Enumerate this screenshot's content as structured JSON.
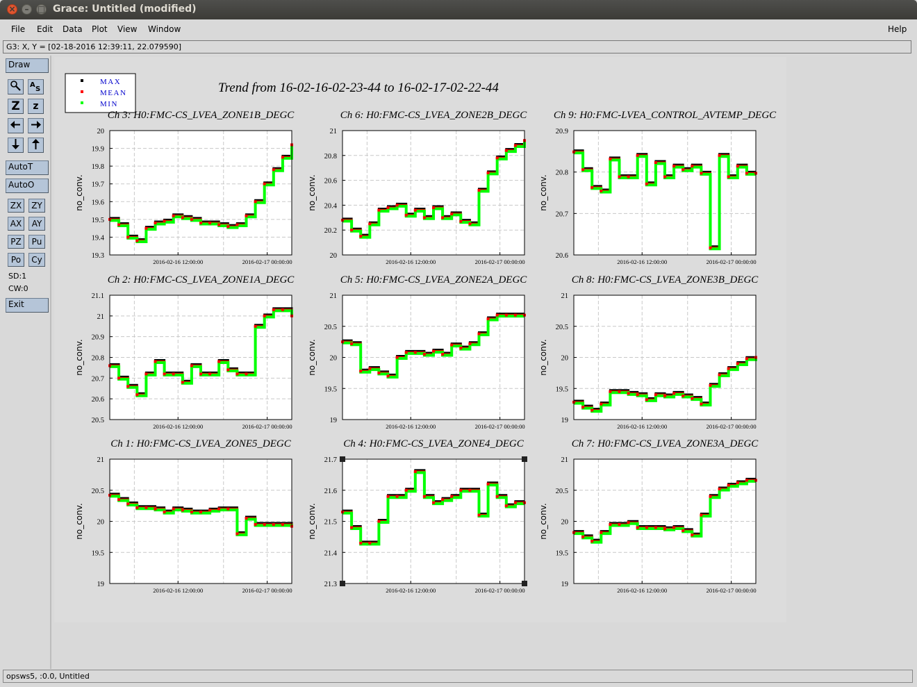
{
  "window": {
    "title": "Grace: Untitled (modified)"
  },
  "menu": {
    "file": "File",
    "edit": "Edit",
    "data": "Data",
    "plot": "Plot",
    "view": "View",
    "window": "Window",
    "help": "Help"
  },
  "locator": {
    "text": "G3: X, Y = [02-18-2016 12:39:11, 22.079590]"
  },
  "toolbar": {
    "draw": "Draw",
    "autot": "AutoT",
    "autoo": "AutoO",
    "zx": "ZX",
    "zy": "ZY",
    "ax": "AX",
    "ay": "AY",
    "pz": "PZ",
    "pu": "Pu",
    "po": "Po",
    "cy": "Cy",
    "sd": "SD:1",
    "cw": "CW:0",
    "exit": "Exit",
    "icons": [
      "magnifier-icon",
      "autoscale-text-icon",
      "zoom-in-icon",
      "zoom-out-icon",
      "arrow-left-icon",
      "arrow-right-icon",
      "arrow-down-icon",
      "arrow-up-icon"
    ],
    "zoom_in_glyph": "Z",
    "zoom_out_glyph": "z"
  },
  "status": {
    "text": "opsws5, :0.0, Untitled"
  },
  "colors": {
    "max": "#000000",
    "mean": "#ff0000",
    "min": "#00ff00",
    "legend_text": "#0000cc",
    "canvas": "#dcdcdc"
  },
  "page_title": "Trend from 16-02-16-02-23-44 to 16-02-17-02-22-44",
  "legend": [
    {
      "label": "MAX"
    },
    {
      "label": "MEAN"
    },
    {
      "label": "MIN"
    }
  ],
  "chart_data": [
    {
      "type": "scatter",
      "title": "Ch 3: H0:FMC-CS_LVEA_ZONE1B_DEGC",
      "ylabel": "no_conv.",
      "ylim": [
        19.3,
        20
      ],
      "yticks": [
        "20",
        "19.9",
        "19.8",
        "19.7",
        "19.6",
        "19.5",
        "19.4",
        "19.3"
      ],
      "xticks": [
        "2016-02-16 12:00:00",
        "2016-02-17 00:00:00"
      ],
      "x": [
        0,
        0.05,
        0.1,
        0.15,
        0.2,
        0.25,
        0.3,
        0.35,
        0.4,
        0.45,
        0.5,
        0.55,
        0.6,
        0.65,
        0.7,
        0.75,
        0.8,
        0.85,
        0.9,
        0.95,
        1
      ],
      "y": [
        19.5,
        19.47,
        19.4,
        19.38,
        19.45,
        19.48,
        19.49,
        19.52,
        19.51,
        19.5,
        19.48,
        19.48,
        19.47,
        19.46,
        19.47,
        19.52,
        19.6,
        19.7,
        19.78,
        19.85,
        19.92
      ]
    },
    {
      "type": "scatter",
      "title": "Ch 6: H0:FMC-CS_LVEA_ZONE2B_DEGC",
      "ylabel": "no_conv.",
      "ylim": [
        20,
        21
      ],
      "yticks": [
        "21",
        "20.8",
        "20.6",
        "20.4",
        "20.2",
        "20"
      ],
      "xticks": [
        "2016-02-16 12:00:00",
        "2016-02-17 00:00:00"
      ],
      "x": [
        0,
        0.05,
        0.1,
        0.15,
        0.2,
        0.25,
        0.3,
        0.35,
        0.4,
        0.45,
        0.5,
        0.55,
        0.6,
        0.65,
        0.7,
        0.75,
        0.8,
        0.85,
        0.9,
        0.95,
        1
      ],
      "y": [
        20.28,
        20.2,
        20.15,
        20.25,
        20.36,
        20.38,
        20.4,
        20.32,
        20.36,
        20.3,
        20.38,
        20.3,
        20.33,
        20.27,
        20.25,
        20.52,
        20.66,
        20.78,
        20.84,
        20.88,
        20.92
      ]
    },
    {
      "type": "scatter",
      "title": "Ch 9: H0:FMC-LVEA_CONTROL_AVTEMP_DEGC",
      "ylabel": "no_conv.",
      "ylim": [
        20.6,
        20.95
      ],
      "yticks": [
        "20.9",
        "20.8",
        "20.7",
        "20.6"
      ],
      "xticks": [
        "2016-02-16 12:00:00",
        "2016-02-17 00:00:00"
      ],
      "x": [
        0,
        0.05,
        0.1,
        0.15,
        0.2,
        0.25,
        0.3,
        0.35,
        0.4,
        0.45,
        0.5,
        0.55,
        0.6,
        0.65,
        0.7,
        0.75,
        0.8,
        0.85,
        0.9,
        0.95,
        1
      ],
      "y": [
        20.89,
        20.84,
        20.79,
        20.78,
        20.87,
        20.82,
        20.82,
        20.88,
        20.8,
        20.86,
        20.82,
        20.85,
        20.84,
        20.85,
        20.83,
        20.62,
        20.88,
        20.82,
        20.85,
        20.83,
        20.83
      ]
    },
    {
      "type": "scatter",
      "title": "Ch 2: H0:FMC-CS_LVEA_ZONE1A_DEGC",
      "ylabel": "no_conv.",
      "ylim": [
        20.5,
        21.1
      ],
      "yticks": [
        "21.1",
        "21",
        "20.9",
        "20.8",
        "20.7",
        "20.6",
        "20.5"
      ],
      "xticks": [
        "2016-02-16 12:00:00",
        "2016-02-17 00:00:00"
      ],
      "x": [
        0,
        0.05,
        0.1,
        0.15,
        0.2,
        0.25,
        0.3,
        0.35,
        0.4,
        0.45,
        0.5,
        0.55,
        0.6,
        0.65,
        0.7,
        0.75,
        0.8,
        0.85,
        0.9,
        0.95,
        1
      ],
      "y": [
        20.76,
        20.7,
        20.66,
        20.62,
        20.72,
        20.78,
        20.72,
        20.72,
        20.68,
        20.76,
        20.72,
        20.72,
        20.78,
        20.74,
        20.72,
        20.72,
        20.95,
        21.0,
        21.03,
        21.03,
        21.0
      ]
    },
    {
      "type": "scatter",
      "title": "Ch 5: H0:FMC-CS_LVEA_ZONE2A_DEGC",
      "ylabel": "no_conv.",
      "ylim": [
        19,
        21
      ],
      "yticks": [
        "21",
        "20.5",
        "20",
        "19.5",
        "19"
      ],
      "xticks": [
        "2016-02-16 12:00:00",
        "2016-02-17 00:00:00"
      ],
      "x": [
        0,
        0.05,
        0.1,
        0.15,
        0.2,
        0.25,
        0.3,
        0.35,
        0.4,
        0.45,
        0.5,
        0.55,
        0.6,
        0.65,
        0.7,
        0.75,
        0.8,
        0.85,
        0.9,
        0.95,
        1
      ],
      "y": [
        20.25,
        20.22,
        19.78,
        19.82,
        19.75,
        19.7,
        20.0,
        20.08,
        20.08,
        20.05,
        20.1,
        20.05,
        20.2,
        20.15,
        20.22,
        20.38,
        20.62,
        20.68,
        20.68,
        20.68,
        20.68
      ]
    },
    {
      "type": "scatter",
      "title": "Ch 8: H0:FMC-CS_LVEA_ZONE3B_DEGC",
      "ylabel": "no_conv.",
      "ylim": [
        19,
        21
      ],
      "yticks": [
        "21",
        "20.5",
        "20",
        "19.5",
        "19"
      ],
      "xticks": [
        "2016-02-16 12:00:00",
        "2016-02-17 00:00:00"
      ],
      "x": [
        0,
        0.05,
        0.1,
        0.15,
        0.2,
        0.25,
        0.3,
        0.35,
        0.4,
        0.45,
        0.5,
        0.55,
        0.6,
        0.65,
        0.7,
        0.75,
        0.8,
        0.85,
        0.9,
        0.95,
        1
      ],
      "y": [
        19.28,
        19.2,
        19.15,
        19.25,
        19.45,
        19.45,
        19.42,
        19.4,
        19.32,
        19.4,
        19.38,
        19.42,
        19.38,
        19.34,
        19.25,
        19.55,
        19.72,
        19.82,
        19.9,
        19.98,
        20.0
      ]
    },
    {
      "type": "scatter",
      "title": "Ch 1: H0:FMC-CS_LVEA_ZONE5_DEGC",
      "ylabel": "no_conv.",
      "ylim": [
        19,
        21
      ],
      "yticks": [
        "21",
        "20.5",
        "20",
        "19.5",
        "19"
      ],
      "xticks": [
        "2016-02-16 12:00:00",
        "2016-02-17 00:00:00"
      ],
      "x": [
        0,
        0.05,
        0.1,
        0.15,
        0.2,
        0.25,
        0.3,
        0.35,
        0.4,
        0.45,
        0.5,
        0.55,
        0.6,
        0.65,
        0.7,
        0.75,
        0.8,
        0.85,
        0.9,
        0.95,
        1
      ],
      "y": [
        20.42,
        20.35,
        20.28,
        20.22,
        20.22,
        20.2,
        20.15,
        20.2,
        20.18,
        20.15,
        20.15,
        20.18,
        20.2,
        20.2,
        19.8,
        20.05,
        19.95,
        19.95,
        19.95,
        19.95,
        19.92
      ]
    },
    {
      "type": "scatter",
      "title": "Ch 4: H0:FMC-CS_LVEA_ZONE4_DEGC",
      "ylabel": "no_conv.",
      "ylim": [
        21.3,
        21.7
      ],
      "yticks": [
        "21.7",
        "21.6",
        "21.5",
        "21.4",
        "21.3"
      ],
      "xticks": [
        "2016-02-16 12:00:00",
        "2016-02-17 00:00:00"
      ],
      "x": [
        0,
        0.05,
        0.1,
        0.15,
        0.2,
        0.25,
        0.3,
        0.35,
        0.4,
        0.45,
        0.5,
        0.55,
        0.6,
        0.65,
        0.7,
        0.75,
        0.8,
        0.85,
        0.9,
        0.95,
        1
      ],
      "y": [
        21.53,
        21.48,
        21.43,
        21.43,
        21.5,
        21.58,
        21.58,
        21.6,
        21.66,
        21.58,
        21.56,
        21.57,
        21.58,
        21.6,
        21.6,
        21.52,
        21.62,
        21.58,
        21.55,
        21.56,
        21.56
      ]
    },
    {
      "type": "scatter",
      "title": "Ch 7: H0:FMC-CS_LVEA_ZONE3A_DEGC",
      "ylabel": "no_conv.",
      "ylim": [
        19,
        21
      ],
      "yticks": [
        "21",
        "20.5",
        "20",
        "19.5",
        "19"
      ],
      "xticks": [
        "2016-02-16 12:00:00",
        "2016-02-17 00:00:00"
      ],
      "x": [
        0,
        0.05,
        0.1,
        0.15,
        0.2,
        0.25,
        0.3,
        0.35,
        0.4,
        0.45,
        0.5,
        0.55,
        0.6,
        0.65,
        0.7,
        0.75,
        0.8,
        0.85,
        0.9,
        0.95,
        1
      ],
      "y": [
        19.82,
        19.75,
        19.68,
        19.82,
        19.95,
        19.95,
        19.98,
        19.9,
        19.9,
        19.9,
        19.88,
        19.9,
        19.85,
        19.78,
        20.1,
        20.4,
        20.52,
        20.58,
        20.62,
        20.66,
        20.66
      ]
    }
  ]
}
